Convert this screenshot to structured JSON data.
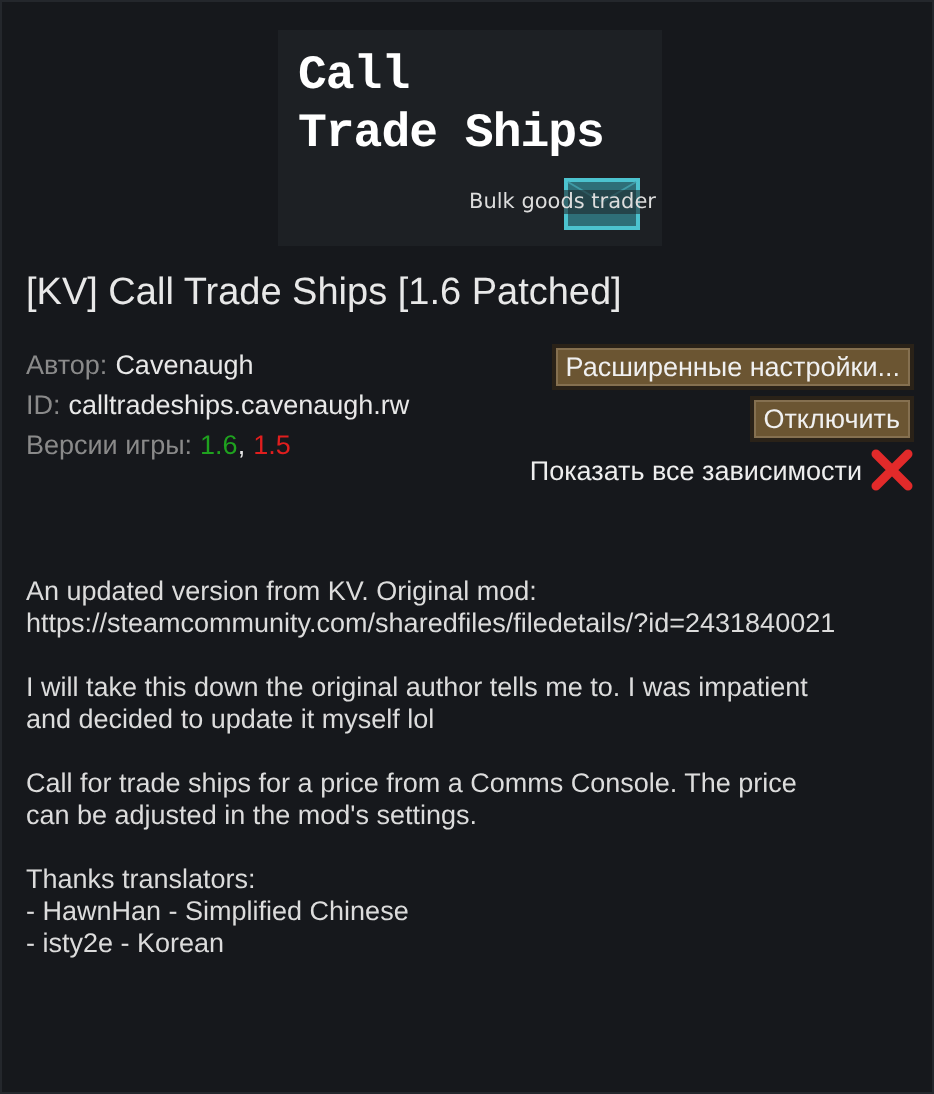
{
  "preview": {
    "kind": "picture",
    "title_lines": [
      "Call",
      "Trade Ships"
    ],
    "caption": "Bulk goods trader"
  },
  "title": "[KV] Call Trade Ships [1.6 Patched]",
  "meta": {
    "author_label": "Автор:",
    "author": "Cavenaugh",
    "id_label": "ID:",
    "id": "calltradeships.cavenaugh.rw",
    "versions_label": "Версии игры:",
    "versions_separator": ",",
    "versions": [
      {
        "text": "1.6",
        "color": "#1fa11f"
      },
      {
        "text": "1.5",
        "color": "#e01e1e"
      }
    ]
  },
  "buttons": [
    "Расширенные настройки...",
    "Отключить"
  ],
  "dependencies": {
    "label": "Показать все зависимости",
    "checked": false
  },
  "description": [
    {
      "lines": [
        "An updated version from KV. Original mod:",
        "https://steamcommunity.com/sharedfiles/filedetails/?id=2431840021"
      ]
    },
    {
      "lines": [
        "I will take this down the original author tells me to. I was impatient",
        "and decided to update it myself lol"
      ]
    },
    {
      "lines": [
        "Call for trade ships for a price from a Comms Console. The price",
        "can be adjusted in the mod's settings."
      ]
    },
    {
      "lines": [
        "Thanks translators:",
        "- HawnHan - Simplified Chinese",
        "- isty2e - Korean"
      ]
    }
  ]
}
